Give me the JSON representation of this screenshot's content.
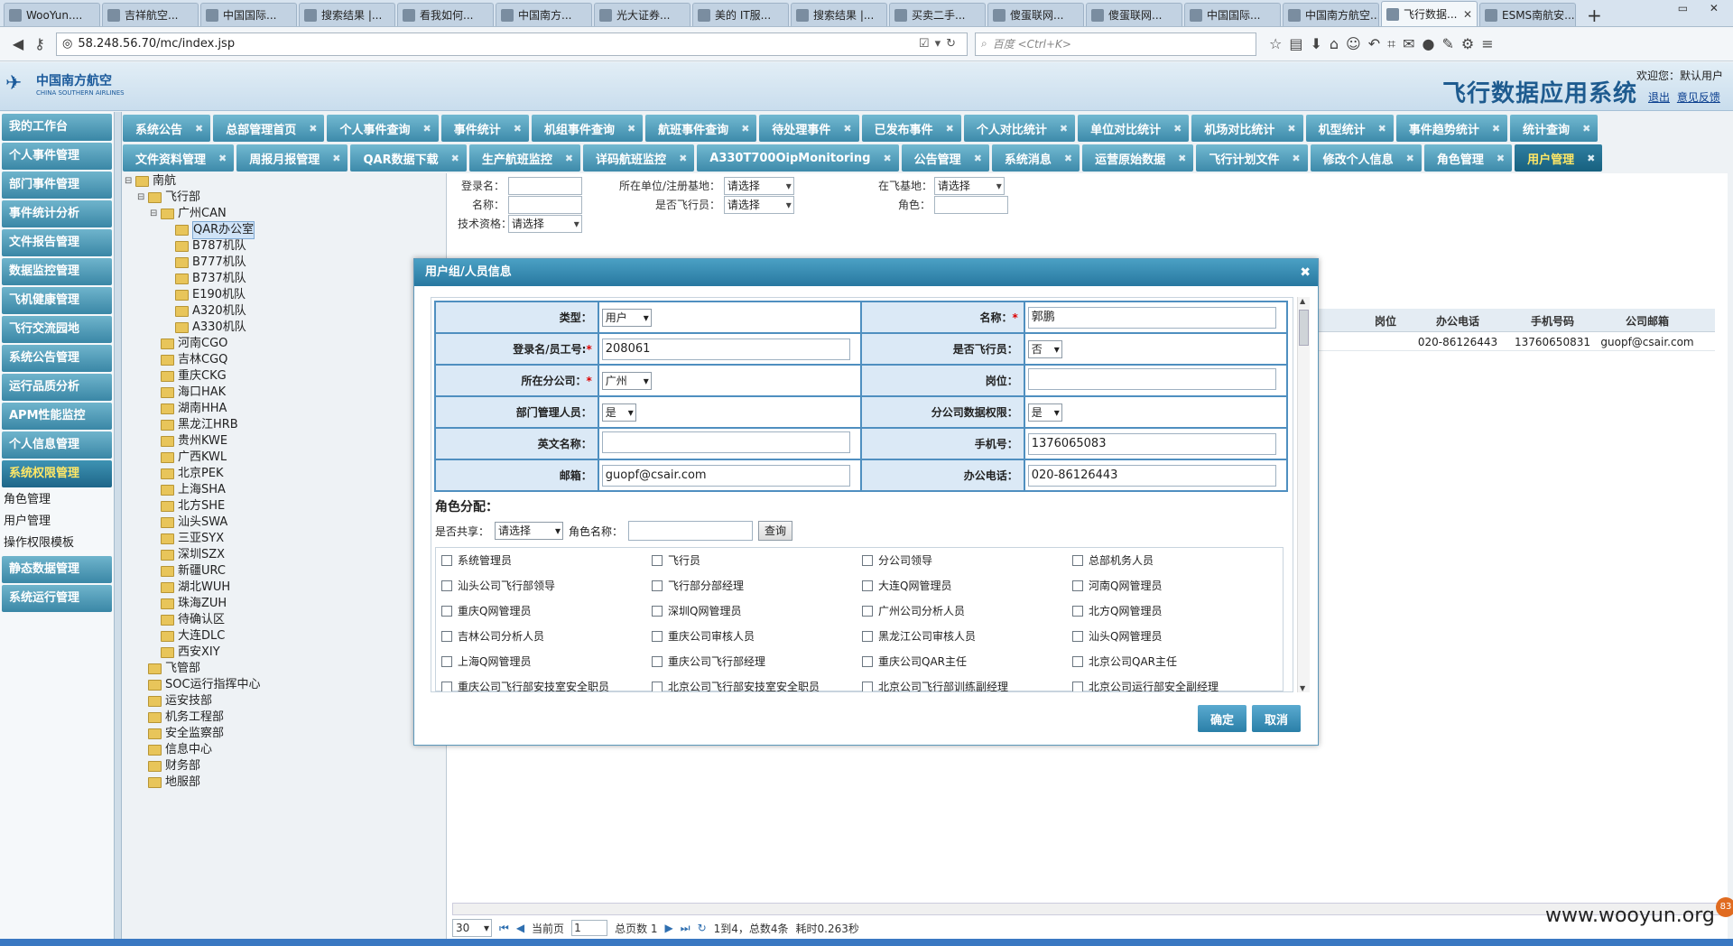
{
  "browser": {
    "tabs": [
      "WooYun....",
      "吉祥航空...",
      "中国国际...",
      "搜索结果 |...",
      "看我如何...",
      "中国南方...",
      "光大证券...",
      "美的 IT服...",
      "搜索结果 |...",
      "买卖二手...",
      "傻蛋联网...",
      "傻蛋联网...",
      "中国国际...",
      "中国南方航空...",
      "飞行数据...",
      "ESMS南航安..."
    ],
    "active_tab_index": 14,
    "url": "58.248.56.70/mc/index.jsp",
    "search_placeholder": "百度 <Ctrl+K>"
  },
  "header": {
    "logo_cn": "中国南方航空",
    "logo_en": "CHINA SOUTHERN AIRLINES",
    "app_title": "飞行数据应用系统",
    "welcome": "欢迎您：默认用户",
    "logout": "退出",
    "feedback": "意见反馈"
  },
  "sidebar": {
    "items": [
      "我的工作台",
      "个人事件管理",
      "部门事件管理",
      "事件统计分析",
      "文件报告管理",
      "数据监控管理",
      "飞机健康管理",
      "飞行交流园地",
      "系统公告管理",
      "运行品质分析",
      "APM性能监控",
      "个人信息管理",
      "系统权限管理"
    ],
    "sub_items": [
      "角色管理",
      "用户管理",
      "操作权限模板"
    ],
    "bottom_items": [
      "静态数据管理",
      "系统运行管理"
    ]
  },
  "topnav": {
    "row1": [
      "系统公告",
      "总部管理首页",
      "个人事件查询",
      "事件统计",
      "机组事件查询",
      "航班事件查询",
      "待处理事件",
      "已发布事件",
      "个人对比统计",
      "单位对比统计",
      "机场对比统计",
      "机型统计",
      "事件趋势统计",
      "统计查询"
    ],
    "row2": [
      "文件资料管理",
      "周报月报管理",
      "QAR数据下载",
      "生产航班监控",
      "详码航班监控",
      "A330T700OipMonitoring",
      "公告管理",
      "系统消息",
      "运营原始数据",
      "飞行计划文件",
      "修改个人信息",
      "角色管理",
      "用户管理"
    ],
    "active": "用户管理"
  },
  "tree": {
    "root": "南航",
    "level1_a": "飞行部",
    "branch": "广州CAN",
    "selected": "QAR办公室",
    "fleets": [
      "B787机队",
      "B777机队",
      "B737机队",
      "E190机队",
      "A320机队",
      "A330机队"
    ],
    "bases": [
      "河南CGO",
      "吉林CGQ",
      "重庆CKG",
      "海口HAK",
      "湖南HHA",
      "黑龙江HRB",
      "贵州KWE",
      "广西KWL",
      "北京PEK",
      "上海SHA",
      "北方SHE",
      "汕头SWA",
      "三亚SYX",
      "深圳SZX",
      "新疆URC",
      "湖北WUH",
      "珠海ZUH",
      "待确认区",
      "大连DLC",
      "西安XIY"
    ],
    "others": [
      "飞管部",
      "SOC运行指挥中心",
      "运安技部",
      "机务工程部",
      "安全监察部",
      "信息中心",
      "财务部",
      "地服部"
    ]
  },
  "filters": {
    "login_label": "登录名：",
    "name_label": "名称：",
    "tech_label": "技术资格：",
    "unit_label": "所在单位/注册基地：",
    "pilot_label": "是否飞行员：",
    "base_label": "在飞基地：",
    "role_label": "角色：",
    "select_default": "请选择"
  },
  "grid": {
    "headers": [
      "岗位",
      "办公电话",
      "手机号码",
      "公司邮箱"
    ],
    "row": [
      "",
      "020-86126443",
      "13760650831",
      "guopf@csair.com"
    ]
  },
  "pager": {
    "page_size": "30",
    "current_label": "当前页",
    "current": "1",
    "total_label": "总页数 1",
    "summary": "1到4，总数4条",
    "elapsed": "耗时0.263秒"
  },
  "modal": {
    "title": "用户组/人员信息",
    "type_label": "类型：",
    "type_value": "用户",
    "name_label": "名称：",
    "name_value": "郭鹏",
    "login_label": "登录名/员工号:",
    "login_value": "208061",
    "pilot_label": "是否飞行员：",
    "pilot_value": "否",
    "branch_label": "所在分公司：",
    "branch_value": "广州",
    "post_label": "岗位：",
    "post_value": "",
    "dept_admin_label": "部门管理人员：",
    "dept_admin_value": "是",
    "data_perm_label": "分公司数据权限：",
    "data_perm_value": "是",
    "en_name_label": "英文名称：",
    "en_name_value": "",
    "mobile_label": "手机号：",
    "mobile_value": "1376065083",
    "email_label": "邮箱：",
    "email_value": "guopf@csair.com",
    "office_label": "办公电话：",
    "office_value": "020-86126443",
    "role_title": "角色分配：",
    "share_label": "是否共享：",
    "share_value": "请选择",
    "role_name_label": "角色名称：",
    "query_button": "查询",
    "roles": [
      "系统管理员",
      "飞行员",
      "分公司领导",
      "总部机务人员",
      "汕头公司飞行部领导",
      "飞行部分部经理",
      "大连Q网管理员",
      "河南Q网管理员",
      "重庆Q网管理员",
      "深圳Q网管理员",
      "广州公司分析人员",
      "北方Q网管理员",
      "吉林公司分析人员",
      "重庆公司审核人员",
      "黑龙江公司审核人员",
      "汕头Q网管理员",
      "上海Q网管理员",
      "重庆公司飞行部经理",
      "重庆公司QAR主任",
      "北京公司QAR主任",
      "重庆公司飞行部安技室安全职员",
      "北京公司飞行部安技室安全职员",
      "北京公司飞行部训练副经理",
      "北京公司运行部安全副经理"
    ],
    "ok_button": "确定",
    "cancel_button": "取消"
  },
  "watermark": "www.wooyun.org",
  "badge": "83"
}
